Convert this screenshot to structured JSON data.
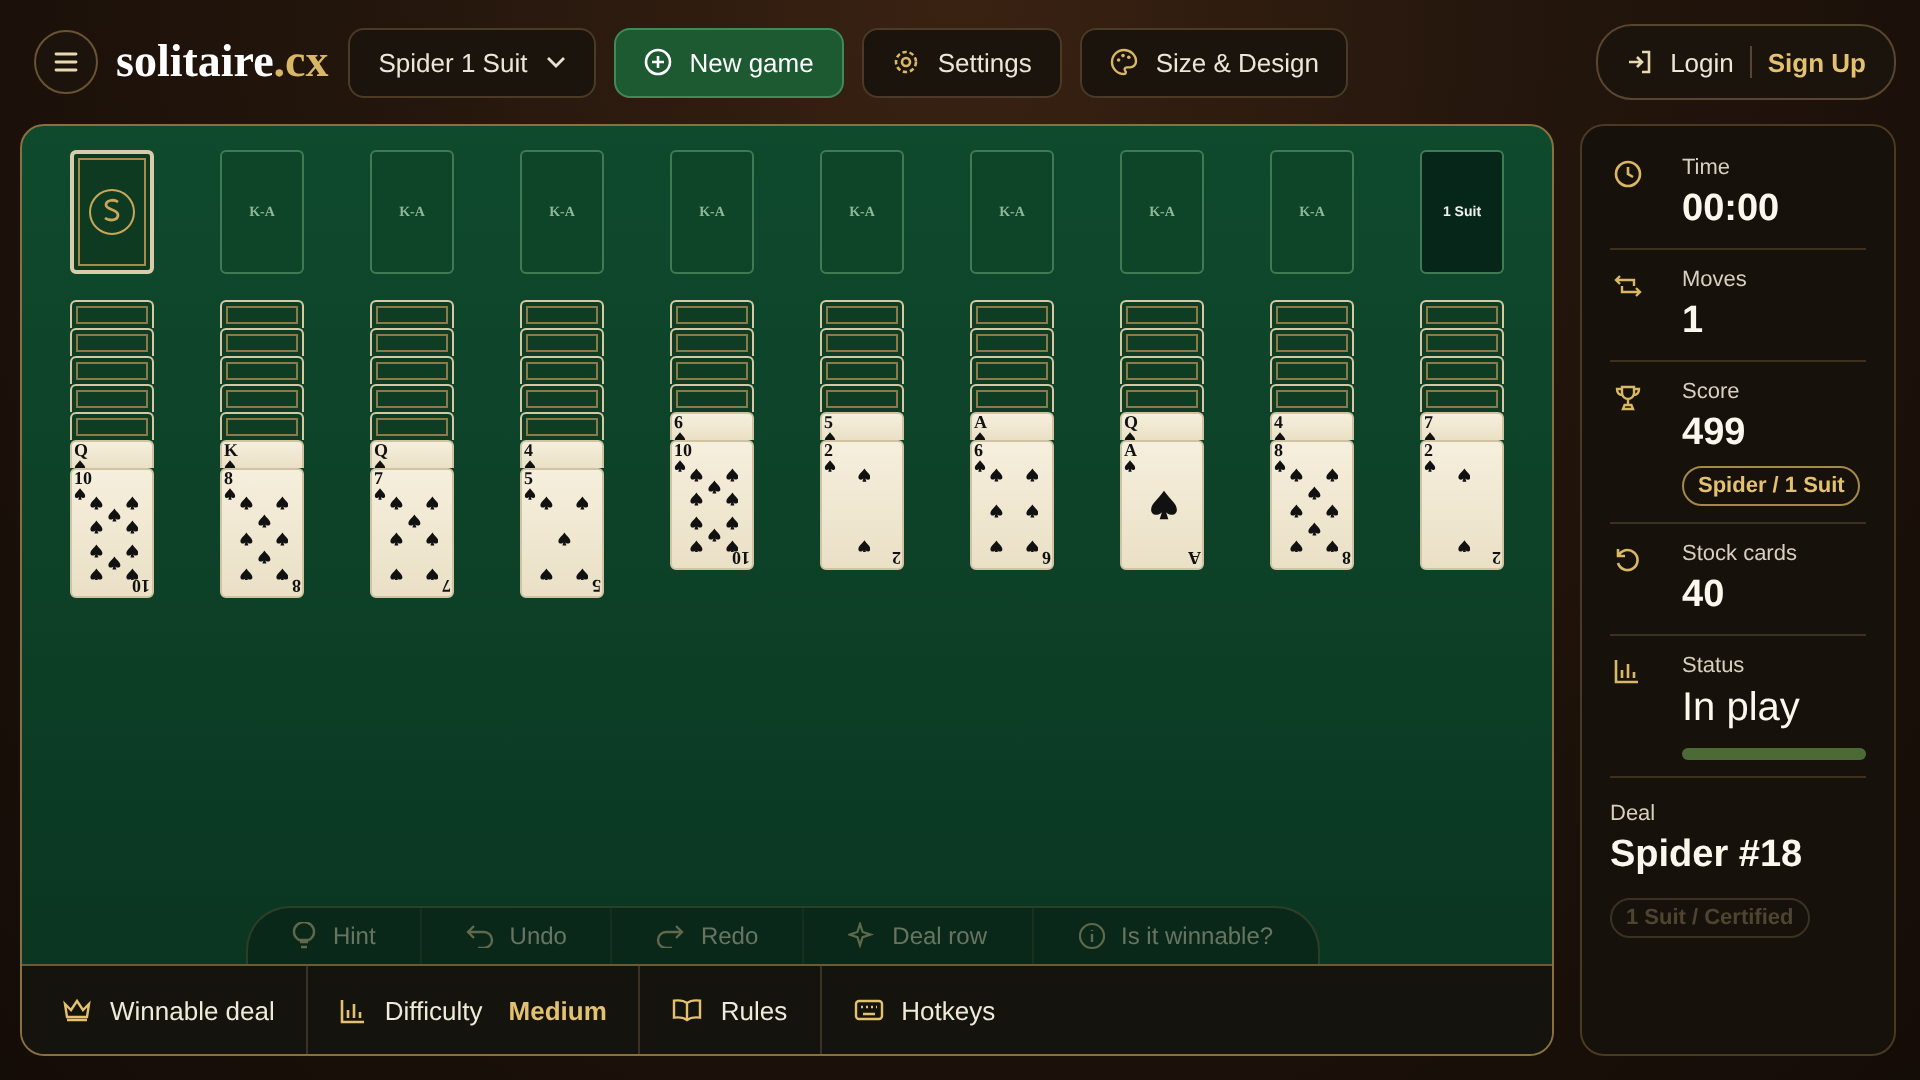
{
  "header": {
    "logo": {
      "name": "solitaire",
      "suffix": ".cx"
    },
    "game_select": "Spider 1 Suit",
    "buttons": [
      {
        "kind": "primary",
        "label": "New game"
      },
      {
        "kind": "settings",
        "label": "Settings"
      },
      {
        "kind": "design",
        "label": "Size & Design"
      }
    ],
    "account": {
      "login": "Login",
      "signup": "Sign Up"
    }
  },
  "foundations": [
    {
      "kind": "stock"
    },
    {
      "kind": "empty",
      "label": "K-A"
    },
    {
      "kind": "empty",
      "label": "K-A"
    },
    {
      "kind": "empty",
      "label": "K-A"
    },
    {
      "kind": "empty",
      "label": "K-A"
    },
    {
      "kind": "empty",
      "label": "K-A"
    },
    {
      "kind": "empty",
      "label": "K-A"
    },
    {
      "kind": "empty",
      "label": "K-A"
    },
    {
      "kind": "empty",
      "label": "K-A"
    },
    {
      "kind": "suit",
      "label": "1 Suit"
    }
  ],
  "tableau": [
    {
      "cards": [
        {
          "face_up": false
        },
        {
          "face_up": false
        },
        {
          "face_up": false
        },
        {
          "face_up": false
        },
        {
          "face_up": false
        },
        {
          "face_up": true,
          "rank": "Q"
        },
        {
          "face_up": true,
          "rank": "10",
          "corner": "10"
        }
      ]
    },
    {
      "cards": [
        {
          "face_up": false
        },
        {
          "face_up": false
        },
        {
          "face_up": false
        },
        {
          "face_up": false
        },
        {
          "face_up": false
        },
        {
          "face_up": true,
          "rank": "K"
        },
        {
          "face_up": true,
          "rank": "8",
          "corner": "8"
        }
      ]
    },
    {
      "cards": [
        {
          "face_up": false
        },
        {
          "face_up": false
        },
        {
          "face_up": false
        },
        {
          "face_up": false
        },
        {
          "face_up": false
        },
        {
          "face_up": true,
          "rank": "Q"
        },
        {
          "face_up": true,
          "rank": "7",
          "corner": "7"
        }
      ]
    },
    {
      "cards": [
        {
          "face_up": false
        },
        {
          "face_up": false
        },
        {
          "face_up": false
        },
        {
          "face_up": false
        },
        {
          "face_up": false
        },
        {
          "face_up": true,
          "rank": "4"
        },
        {
          "face_up": true,
          "rank": "5",
          "corner": "5"
        }
      ]
    },
    {
      "cards": [
        {
          "face_up": false
        },
        {
          "face_up": false
        },
        {
          "face_up": false
        },
        {
          "face_up": false
        },
        {
          "face_up": true,
          "rank": "6"
        },
        {
          "face_up": true,
          "rank": "10",
          "corner": "10"
        }
      ]
    },
    {
      "cards": [
        {
          "face_up": false
        },
        {
          "face_up": false
        },
        {
          "face_up": false
        },
        {
          "face_up": false
        },
        {
          "face_up": true,
          "rank": "5"
        },
        {
          "face_up": true,
          "rank": "2",
          "corner": "2"
        }
      ]
    },
    {
      "cards": [
        {
          "face_up": false
        },
        {
          "face_up": false
        },
        {
          "face_up": false
        },
        {
          "face_up": false
        },
        {
          "face_up": true,
          "rank": "A"
        },
        {
          "face_up": true,
          "rank": "6",
          "corner": "6"
        }
      ]
    },
    {
      "cards": [
        {
          "face_up": false
        },
        {
          "face_up": false
        },
        {
          "face_up": false
        },
        {
          "face_up": false
        },
        {
          "face_up": true,
          "rank": "Q"
        },
        {
          "face_up": true,
          "rank": "A",
          "corner": "A"
        }
      ]
    },
    {
      "cards": [
        {
          "face_up": false
        },
        {
          "face_up": false
        },
        {
          "face_up": false
        },
        {
          "face_up": false
        },
        {
          "face_up": true,
          "rank": "4"
        },
        {
          "face_up": true,
          "rank": "8",
          "corner": "8"
        }
      ]
    },
    {
      "cards": [
        {
          "face_up": false
        },
        {
          "face_up": false
        },
        {
          "face_up": false
        },
        {
          "face_up": false
        },
        {
          "face_up": true,
          "rank": "7"
        },
        {
          "face_up": true,
          "rank": "2",
          "corner": "2"
        }
      ]
    }
  ],
  "actions": [
    {
      "kind": "hint",
      "label": "Hint",
      "disabled": true
    },
    {
      "kind": "undo",
      "label": "Undo",
      "disabled": true
    },
    {
      "kind": "redo",
      "label": "Redo",
      "disabled": true
    },
    {
      "kind": "deal",
      "label": "Deal row",
      "disabled": true
    },
    {
      "kind": "winnable",
      "label": "Is it winnable?",
      "disabled": true
    }
  ],
  "bottom_bar": [
    {
      "kind": "winnable",
      "label": "Winnable deal"
    },
    {
      "kind": "difficulty",
      "label": "Difficulty",
      "value": "Medium"
    },
    {
      "kind": "rules",
      "label": "Rules"
    },
    {
      "kind": "hotkeys",
      "label": "Hotkeys"
    }
  ],
  "stats": [
    {
      "kind": "time",
      "label": "Time",
      "value": "00:00"
    },
    {
      "kind": "moves",
      "label": "Moves",
      "value": "1"
    },
    {
      "kind": "score",
      "label": "Score",
      "value": "499",
      "badge": "Spider / 1 Suit"
    },
    {
      "kind": "stock",
      "label": "Stock cards",
      "value": "40"
    },
    {
      "kind": "status",
      "label": "Status",
      "value": "In play",
      "level": 1
    }
  ],
  "deal": {
    "label": "Deal",
    "value": "Spider #18",
    "badge": "1 Suit / Certified"
  }
}
